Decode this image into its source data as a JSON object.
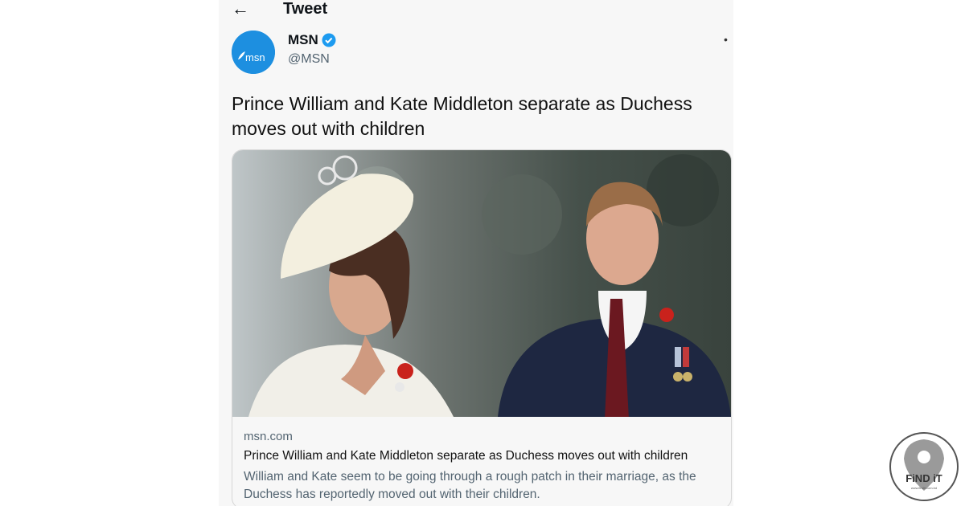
{
  "header": {
    "back_icon": "arrow-left-icon",
    "title": "Tweet"
  },
  "author": {
    "name": "MSN",
    "handle": "@MSN",
    "verified_icon": "verified-badge-icon",
    "avatar_text": "msn",
    "avatar_color": "#1d8fe0"
  },
  "more_icon": "more-dots-icon",
  "tweet_text": "Prince William and Kate Middleton separate as Duchess moves out with children",
  "card": {
    "domain": "msn.com",
    "title": "Prince William and Kate Middleton separate as Duchess moves out with children",
    "description": "William and Kate seem to be going through a rough patch in their marriage, as the Duchess has reportedly moved out with their children."
  },
  "watermark": {
    "text": "FiND iT",
    "subtext": "www.findit.com.bd"
  },
  "colors": {
    "verified": "#1d9bf0",
    "muted": "#536471",
    "brand": "#1d8fe0"
  }
}
